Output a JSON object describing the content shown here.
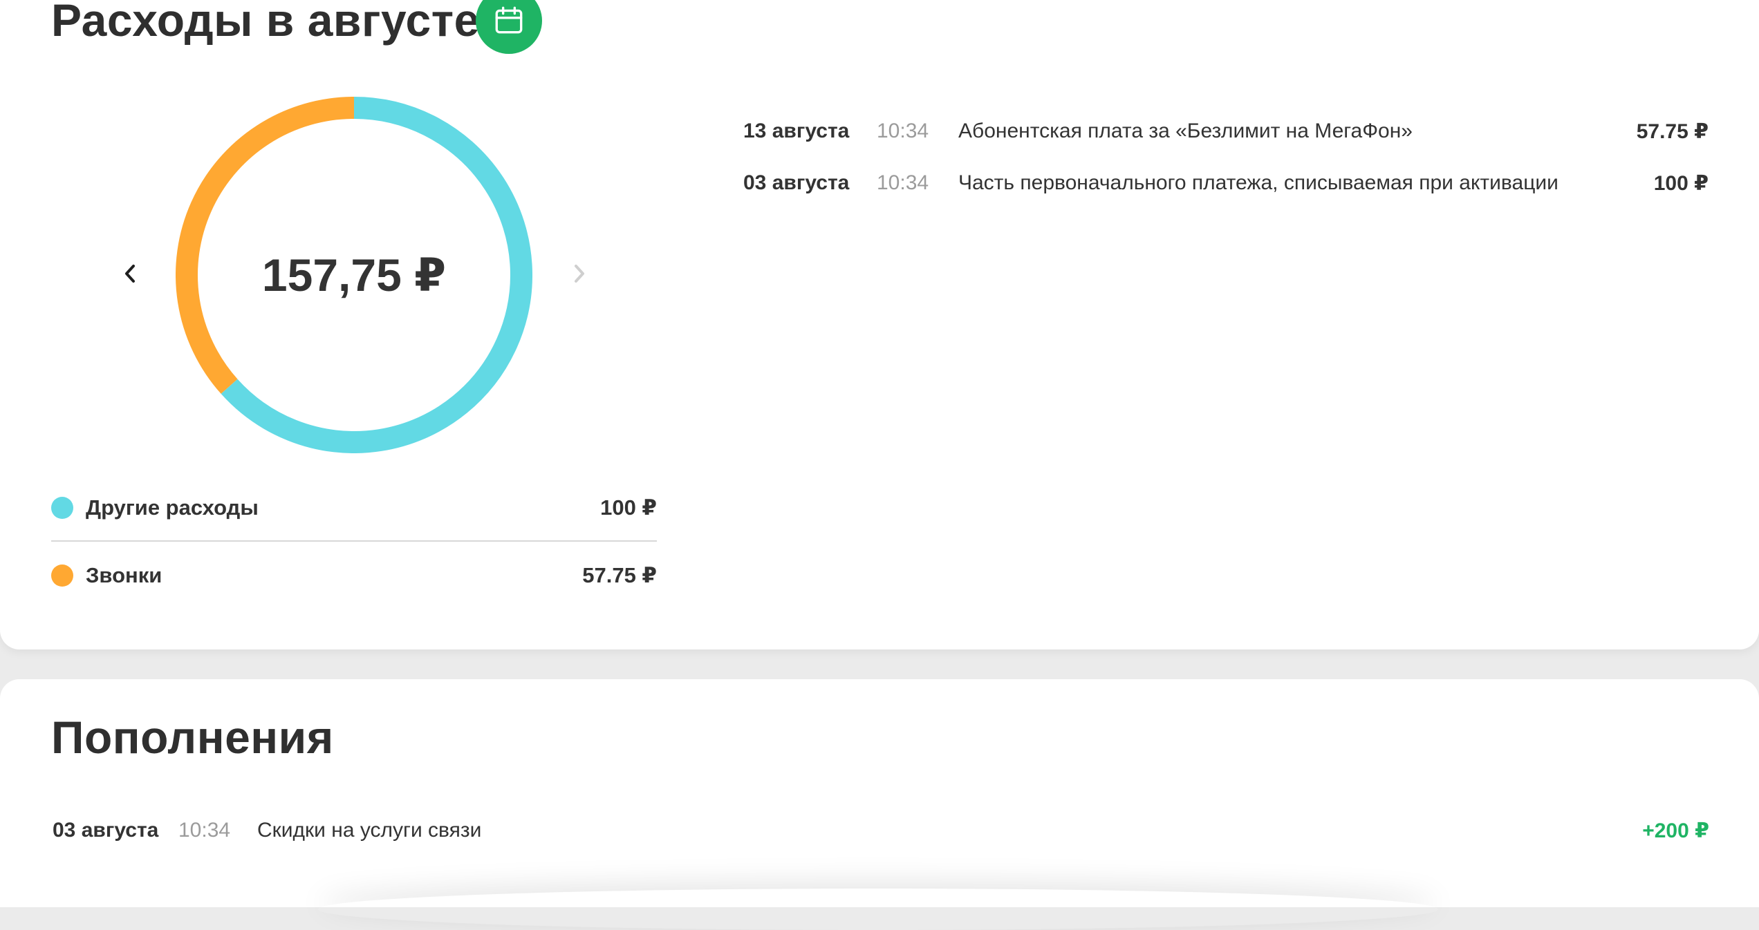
{
  "expenses": {
    "title": "Расходы в августе",
    "calendar_icon": "calendar-icon",
    "total": "157,75 ₽",
    "prev_icon": "chevron-left-icon",
    "next_icon": "chevron-right-icon",
    "donut": {
      "segments": [
        {
          "label": "Другие расходы",
          "value": 100,
          "color": "#62d9e4"
        },
        {
          "label": "Звонки",
          "value": 57.75,
          "color": "#ffa832"
        }
      ]
    },
    "legend": [
      {
        "label": "Другие расходы",
        "amount": "100 ₽",
        "color": "#62d9e4"
      },
      {
        "label": "Звонки",
        "amount": "57.75 ₽",
        "color": "#ffa832"
      }
    ],
    "transactions": [
      {
        "date": "13 августа",
        "time": "10:34",
        "description": "Абонентская плата за «Безлимит на МегаФон»",
        "amount": "57.75 ₽"
      },
      {
        "date": "03 августа",
        "time": "10:34",
        "description": "Часть первоначального платежа, списываемая при активации",
        "amount": "100 ₽"
      }
    ]
  },
  "topups": {
    "title": "Пополнения",
    "items": [
      {
        "date": "03 августа",
        "time": "10:34",
        "description": "Скидки на услуги связи",
        "amount": "+200 ₽"
      }
    ]
  },
  "colors": {
    "accent_green": "#1fb464",
    "other_expenses": "#62d9e4",
    "calls": "#ffa832"
  }
}
